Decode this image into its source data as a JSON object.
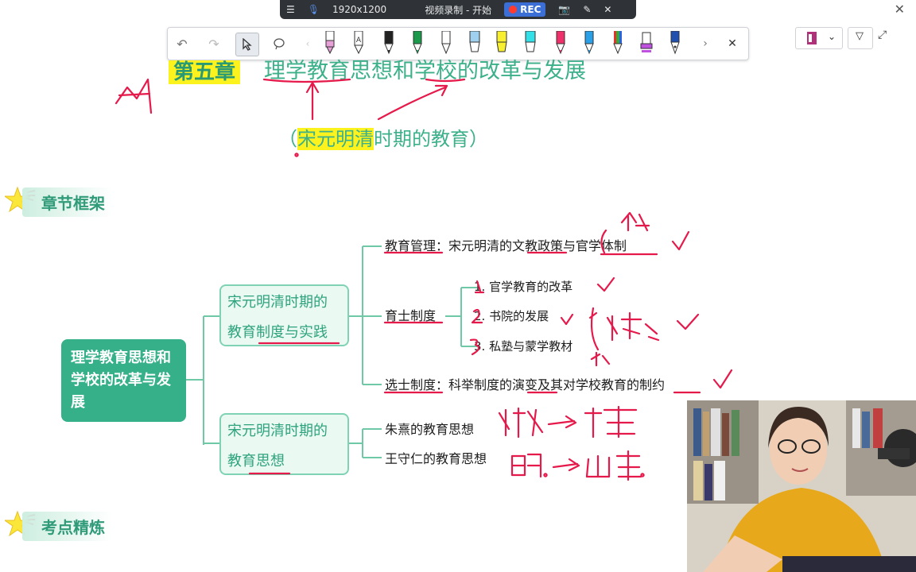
{
  "recorder": {
    "menu_icon": "menu-icon",
    "resolution": "1920x1200",
    "title": "视频录制 - 开始",
    "rec_label": "REC"
  },
  "toolbar": {
    "tools": [
      "undo-icon",
      "redo-icon",
      "cursor-icon",
      "lasso-icon"
    ],
    "pen_colors": [
      "#e8a0d8",
      "#ffffff",
      "#222222",
      "#1a9a4a",
      "#ffffff",
      "#9fd0f0",
      "#f7ef30",
      "#33e0e8",
      "#f0306a",
      "#2aa0e8",
      "#e89030",
      "#c050e0",
      "#2050b0"
    ]
  },
  "content": {
    "chapter_label": "第五章",
    "chapter_title": "理学教育思想和学校的改革与发展",
    "subtitle_hl": "宋元明清",
    "subtitle_rest": "时期的教育）",
    "subtitle_open": "（",
    "section_framework": "章节框架",
    "section_practice": "考点精炼"
  },
  "mindmap": {
    "root": "理学教育思想和学校的改革与发展",
    "branch1": "宋元明清时期的教育制度与实践",
    "branch2": "宋元明清时期的教育思想",
    "mgmt_label": "教育管理",
    "mgmt_text": "：宋元明清的文教政策与官学体制",
    "yushi_label": "育士制度",
    "yushi_items": [
      "1. 官学教育的改革",
      "2. 书院的发展",
      "3. 私塾与蒙学教材"
    ],
    "xuanshi_label": "选士制度",
    "xuanshi_text": "：科举制度的演变及其对学校教育的制约",
    "thinkers": [
      "朱熹的教育思想",
      "王守仁的教育思想"
    ]
  },
  "colors": {
    "accent": "#35b088",
    "highlight": "#fbf21e",
    "ink": "#e6194b"
  }
}
